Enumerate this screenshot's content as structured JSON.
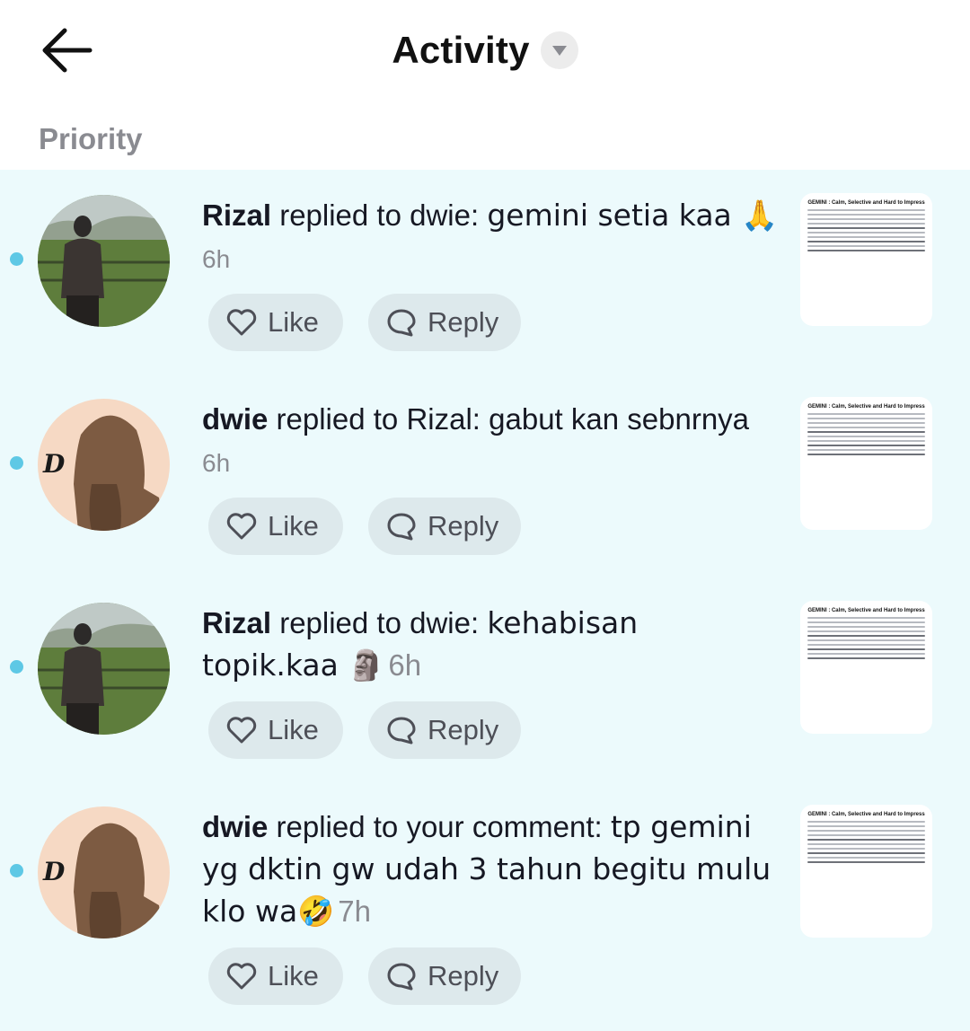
{
  "header": {
    "title": "Activity"
  },
  "section": {
    "label": "Priority"
  },
  "buttons": {
    "like": "Like",
    "reply": "Reply"
  },
  "thumbnail": {
    "title": "GEMINI :\nCalm, Selective and Hard to Impress"
  },
  "colors": {
    "unread_dot": "#5ec8e5",
    "list_bg": "#ecfafc",
    "button_bg": "#dde9ec"
  },
  "items": [
    {
      "user": "Rizal",
      "action": " replied to dwie: ",
      "message": "gemini setia kaa 🙏",
      "time": "6h",
      "avatar": "landscape-avatar"
    },
    {
      "user": "dwie",
      "action": " replied to Rizal: ",
      "message": "gabut kan sebnrnya",
      "time": "6h",
      "avatar": "hijab-avatar"
    },
    {
      "user": "Rizal",
      "action": " replied to dwie: ",
      "message": "kehabisan topik.kaa 🗿",
      "time": "6h",
      "avatar": "landscape-avatar"
    },
    {
      "user": "dwie",
      "action": " replied to your comment: ",
      "message": "tp gemini yg dktin gw udah 3 tahun begitu mulu klo wa🤣",
      "time": "7h",
      "avatar": "hijab-avatar"
    }
  ]
}
